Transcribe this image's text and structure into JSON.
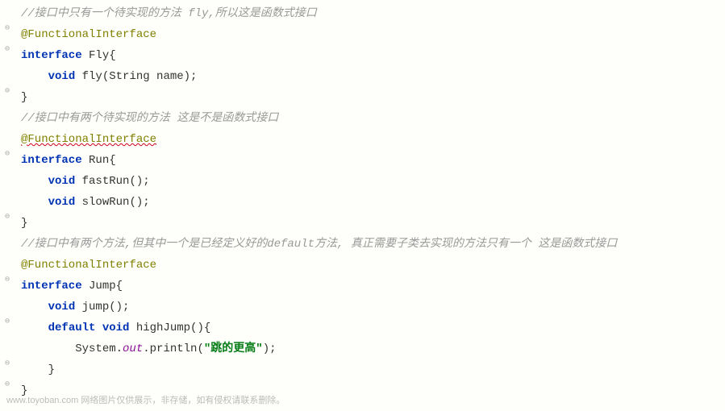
{
  "lines": {
    "l1_comment": "//接口中只有一个待实现的方法 fly,所以这是函数式接口",
    "l2_annotation": "@FunctionalInterface",
    "l3_keyword1": "interface ",
    "l3_name": "Fly",
    "l3_brace": "{",
    "l4_keyword": "void ",
    "l4_method": "fly",
    "l4_params": "(String name);",
    "l5_brace": "}",
    "l6_comment": "//接口中有两个待实现的方法 这是不是函数式接口",
    "l7_annotation": "@FunctionalInterface",
    "l8_keyword1": "interface ",
    "l8_name": "Run",
    "l8_brace": "{",
    "l9_keyword": "void ",
    "l9_method": "fastRun",
    "l9_params": "();",
    "l10_keyword": "void ",
    "l10_method": "slowRun",
    "l10_params": "();",
    "l11_brace": "}",
    "l12_comment": "//接口中有两个方法,但其中一个是已经定义好的default方法, 真正需要子类去实现的方法只有一个 这是函数式接口",
    "l13_annotation": "@FunctionalInterface",
    "l14_keyword1": "interface ",
    "l14_name": "Jump",
    "l14_brace": "{",
    "l15_keyword": "void ",
    "l15_method": "jump",
    "l15_params": "();",
    "l16_keyword1": "default void ",
    "l16_method": "highJump",
    "l16_params": "(){",
    "l17_sys": "System.",
    "l17_out": "out",
    "l17_print": ".println(",
    "l17_string": "\"跳的更高\"",
    "l17_end": ");",
    "l18_brace": "}",
    "l19_brace": "}"
  },
  "watermark": "www.toyoban.com 网络图片仅供展示，非存储，如有侵权请联系删除。"
}
